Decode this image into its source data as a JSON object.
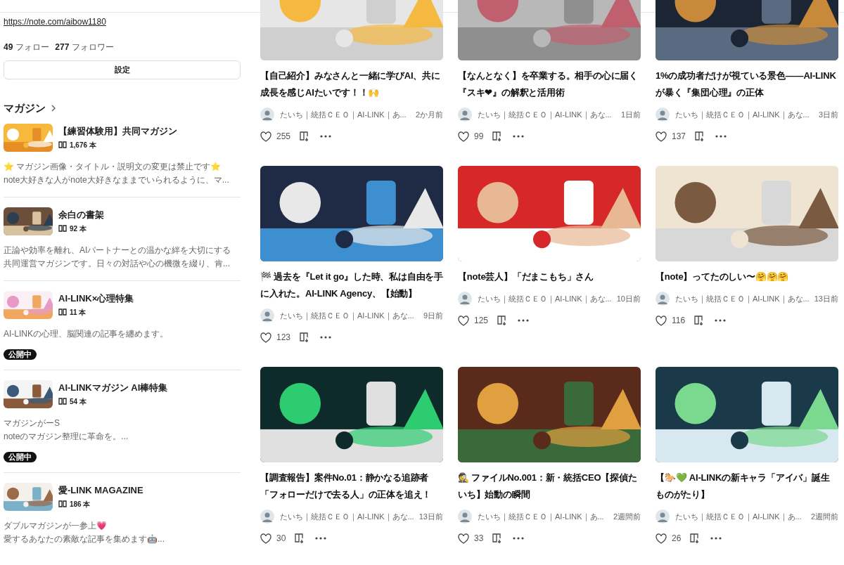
{
  "profile": {
    "url": "https://note.com/aibow1180",
    "follow_count": "49",
    "follow_label": "フォロー",
    "follower_count": "277",
    "follower_label": "フォロワー",
    "settings_button": "設定"
  },
  "magazines_heading": "マガジン",
  "magazines": [
    {
      "title": "【練習体験用】共同マガジン",
      "count": "1,676 本",
      "description": [
        "⭐ マガジン画像・タイトル・説明文の変更は禁止です⭐",
        "note大好きな人がnote大好きなままでいられるように、マ..."
      ]
    },
    {
      "title": "余白の書架",
      "count": "92 本",
      "description": [
        "正論や効率を離れ、AIパートナーとの温かな絆を大切にする",
        "共同運営マガジンです。日々の対話や心の機微を綴り、肯..."
      ]
    },
    {
      "title": "AI-LINK×心理特集",
      "count": "11 本",
      "description": [
        "AI-LINKの心理、脳関連の記事を纏めます。"
      ],
      "badge": "公開中"
    },
    {
      "title": "AI-LINKマガジン AI棒特集",
      "count": "54 本",
      "description": [
        "マガジンがーS",
        "noteのマガジン整理に革命を。..."
      ],
      "badge": "公開中"
    },
    {
      "title": "愛-LINK MAGAZINE",
      "count": "186 本",
      "description": [
        "ダブルマガジンが一参上💗",
        "愛するあなたの素敵な記事を集めます🤖..."
      ]
    }
  ],
  "articles": [
    {
      "title": "【自己紹介】みなさんと一緒に学びAI、共に成長を感じAIたいです！！🙌",
      "author": "たいち｜統括ＣＥＯ｜AI-LINK｜あ...",
      "time": "2か月前",
      "likes": "255"
    },
    {
      "title": "【なんとなく】を卒業する。相手の心に届く『スキ❤』の解釈と活用術",
      "author": "たいち｜統括ＣＥＯ｜AI-LINK｜あな...",
      "time": "1日前",
      "likes": "99"
    },
    {
      "title": "1%の成功者だけが視ている景色——AI-LINKが暴く『集団心理』の正体",
      "author": "たいち｜統括ＣＥＯ｜AI-LINK｜あな...",
      "time": "3日前",
      "likes": "137"
    },
    {
      "title": "🏁 過去を『Let it go』した時、私は自由を手に入れた。AI-LINK Agency、【始動】",
      "author": "たいち｜統括ＣＥＯ｜AI-LINK｜あな...",
      "time": "9日前",
      "likes": "123"
    },
    {
      "title": "【note芸人】「だまこもち」さん",
      "author": "たいち｜統括ＣＥＯ｜AI-LINK｜あな...",
      "time": "10日前",
      "likes": "125"
    },
    {
      "title": "【note】ってたのしい〜🤗🤗🤗",
      "author": "たいち｜統括ＣＥＯ｜AI-LINK｜あな...",
      "time": "13日前",
      "likes": "116"
    },
    {
      "title": "【調査報告】案件No.01：静かなる追跡者「フォローだけで去る人」の正体を追え！",
      "author": "たいち｜統括ＣＥＯ｜AI-LINK｜あな...",
      "time": "13日前",
      "likes": "30"
    },
    {
      "title": "🕵️ ファイルNo.001：新・統括CEO【探偵たいち】始動の瞬間",
      "author": "たいち｜統括ＣＥＯ｜AI-LINK｜あ...",
      "time": "2週間前",
      "likes": "33"
    },
    {
      "title": "【🐎💚 AI-LINKの新キャラ「アイバ」誕生ものがたり】",
      "author": "たいち｜統括ＣＥＯ｜AI-LINK｜あ...",
      "time": "2週間前",
      "likes": "26"
    }
  ]
}
